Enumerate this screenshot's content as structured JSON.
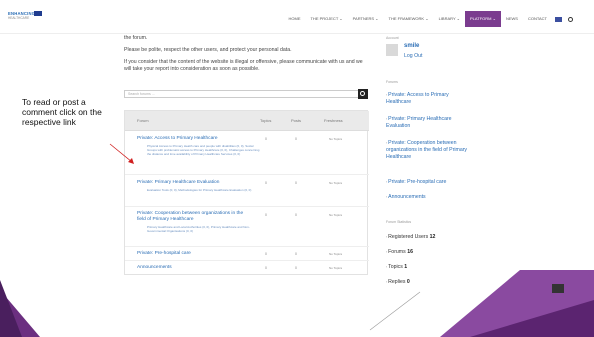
{
  "logo": {
    "line1": "ENHANCING",
    "line2": "HEALTHCARE"
  },
  "nav": {
    "items": [
      {
        "label": "HOME"
      },
      {
        "label": "THE PROJECT ⌄"
      },
      {
        "label": "PARTNERS ⌄"
      },
      {
        "label": "THE FRAMEWORK ⌄"
      },
      {
        "label": "LIBRARY ⌄"
      },
      {
        "label": "PLATFORM ⌄",
        "active": true
      },
      {
        "label": "NEWS"
      },
      {
        "label": "CONTACT"
      }
    ]
  },
  "main": {
    "p1": "the forum.",
    "p2": "Please be polite, respect the other users, and protect your personal data.",
    "p3": "If you consider that the content of the website is illegal or offensive, please communicate with us and we will take your report into consideration as soon as possible.",
    "search_placeholder": "Search forums ..."
  },
  "forum_table": {
    "headers": {
      "forum": "Forum",
      "topics": "Topics",
      "posts": "Posts",
      "freshness": "Freshness"
    },
    "rows": [
      {
        "title": "Private: Access to Primary Healthcare",
        "desc": "Physical Access to Primary Health care and people with disabilities (0, 0), Social Groups with problematic access to Primary Healthcare (0, 0), Challenges concerning the distance and time availability of Primary Healthcare Services (0, 0)",
        "topics": "0",
        "posts": "0",
        "freshness": "No Topics"
      },
      {
        "title": "Private: Primary Healthcare Evaluation",
        "desc": "Evaluation Tools (0, 0), Methodologies for Primary Healthcare Evaluation (0, 0)",
        "topics": "0",
        "posts": "0",
        "freshness": "No Topics"
      },
      {
        "title": "Private: Cooperation between organizations in the field of Primary Healthcare",
        "desc": "Primary Healthcare and Local Authorities (0, 0), Primary Healthcare and Non-Governmental Organisations (0, 0)",
        "topics": "0",
        "posts": "0",
        "freshness": "No Topics"
      },
      {
        "title": "Private: Pre-hospital care",
        "desc": "",
        "topics": "0",
        "posts": "0",
        "freshness": "No Topics"
      },
      {
        "title": "Announcements",
        "desc": "",
        "topics": "0",
        "posts": "0",
        "freshness": "No Topics"
      }
    ]
  },
  "sidebar": {
    "account_heading": "Account",
    "username": "smile",
    "logout": "Log Out",
    "forums_heading": "Forums",
    "forums": [
      "Private: Access to Primary Healthcare",
      "Private: Primary Healthcare Evaluation",
      "Private: Cooperation between organizations in the field of Primary Healthcare",
      "Private: Pre-hospital care",
      "Announcements"
    ],
    "stats_heading": "Forum Statistics",
    "stats": [
      {
        "label": "Registered Users",
        "value": "12"
      },
      {
        "label": "Forums",
        "value": "16"
      },
      {
        "label": "Topics",
        "value": "1"
      },
      {
        "label": "Replies",
        "value": "0"
      }
    ]
  },
  "annotation": "To read or post a comment click on the respective link",
  "colors": {
    "accent_purple": "#7b3c8f",
    "link_blue": "#2a6db5"
  }
}
